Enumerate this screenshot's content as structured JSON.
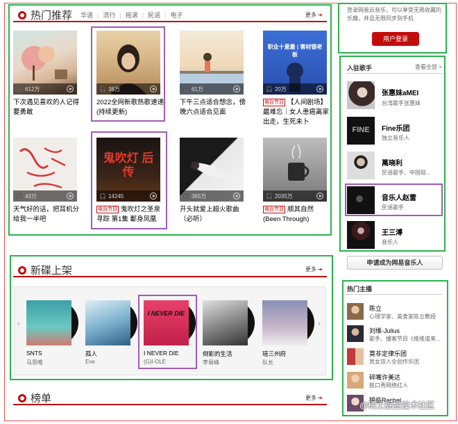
{
  "hot": {
    "title": "热门推荐",
    "tabs": [
      "华语",
      "流行",
      "摇滚",
      "民谣",
      "电子"
    ],
    "more": "更多",
    "items": [
      {
        "count": "612万",
        "desc": "下次遇见喜欢的人记得要勇敢",
        "tag": ""
      },
      {
        "count": "38万",
        "desc": "2022全网新歌热歌速递(持续更新)",
        "tag": ""
      },
      {
        "count": "61万",
        "desc": "下午三点适合想念，傍晚六点适合见面",
        "tag": ""
      },
      {
        "count": "20万",
        "desc": "【人间剧场】最难忘｜女人患癌离家出走，生死未卜",
        "tag": "电台节目"
      },
      {
        "count": "43万",
        "desc": "天气好的话，把耳机分给我一半吧",
        "tag": ""
      },
      {
        "count": "14245",
        "desc": "鬼吹灯之圣泉寻踪 第1集 鄱身凤凰",
        "tag": "电台节目"
      },
      {
        "count": "365万",
        "desc": "开头就爱上超火歌曲（必听）",
        "tag": ""
      },
      {
        "count": "2035万",
        "desc": "顺其自然 (Been Through)",
        "tag": "电台节目"
      }
    ],
    "cover2_text": "",
    "cover4_text": "职业十意最 | 害材银老板",
    "cover6_text": "鬼吹灯 后传"
  },
  "albums": {
    "title": "新碟上架",
    "more": "更多",
    "items": [
      {
        "title": "SNTS",
        "artist": "马思唯"
      },
      {
        "title": "孤人",
        "artist": "Eve"
      },
      {
        "title": "I NEVER DIE",
        "artist": "(G)I-DLE"
      },
      {
        "title": "倒影的生活",
        "artist": "李易峰"
      },
      {
        "title": "瑶三州府",
        "artist": "队长"
      }
    ],
    "cover3_text": "I NEVER DIE"
  },
  "chart": {
    "title": "榜单"
  },
  "login": {
    "text": "登录网易云音乐，可以享受无限收藏的乐趣，并且无限同步到手机",
    "button": "用户登录"
  },
  "singers": {
    "title": "入驻歌手",
    "more": "查看全部 >",
    "items": [
      {
        "name": "张惠妹aMEI",
        "desc": "台湾歌手张惠妹"
      },
      {
        "name": "Fine乐团",
        "desc": "独立音乐人"
      },
      {
        "name": "萬晓利",
        "desc": "民谣歌手、中国现..."
      },
      {
        "name": "音乐人赵雷",
        "desc": "民谣歌手"
      },
      {
        "name": "王三溥",
        "desc": "音乐人"
      }
    ],
    "fine_logo": "FINE",
    "apply": "申请成为网易音乐人"
  },
  "djs": {
    "title": "热门主播",
    "items": [
      {
        "name": "陈立",
        "desc": "心理学家、美食家陈立教授"
      },
      {
        "name": "刘维-Julius",
        "desc": "歌手、播客节目《维维道来..."
      },
      {
        "name": "莫非定律乐团",
        "desc": "男女双人全创作乐团"
      },
      {
        "name": "碎嘴许美达",
        "desc": "脱口秀网络红人"
      },
      {
        "name": "银临Rachel",
        "desc": ""
      }
    ]
  },
  "watermark": "@稀土掘金技术社区",
  "colors": {
    "accent": "#c20c0c",
    "frame_green": "#2bb24c",
    "frame_purple": "#a05bb5",
    "frame_red": "#e05050"
  }
}
